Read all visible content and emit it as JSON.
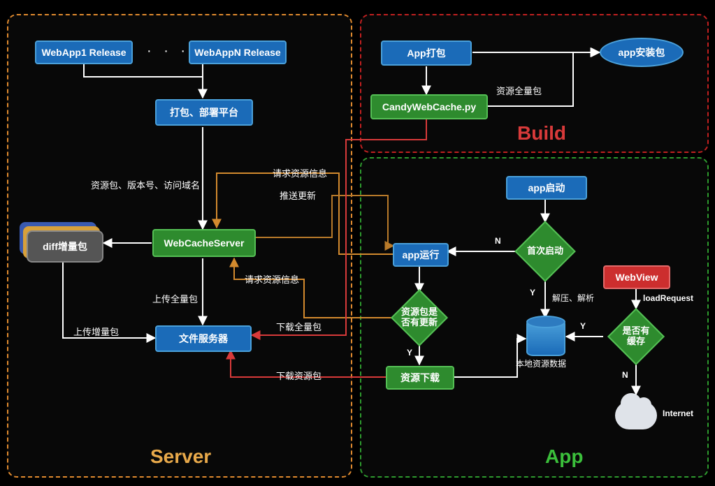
{
  "panels": {
    "server": {
      "label": "Server"
    },
    "build": {
      "label": "Build"
    },
    "app": {
      "label": "App"
    }
  },
  "nodes": {
    "webapp1": "WebApp1 Release",
    "webappn": "WebAppN Release",
    "ellipsis": "· · ·",
    "pack_platform": "打包、部署平台",
    "webcacheserver": "WebCacheServer",
    "fileserver": "文件服务器",
    "diff_pkg": "diff增量包",
    "app_pack": "App打包",
    "candy": "CandyWebCache.py",
    "app_install": "app安装包",
    "app_start": "app启动",
    "app_run": "app运行",
    "first_launch": "首次启动",
    "res_has_update": "资源包是\n否有更新",
    "res_download": "资源下载",
    "webview": "WebView",
    "has_cache": "是否有\n缓存",
    "internet": "Internet"
  },
  "edges": {
    "res_version_domain": "资源包、版本号、访问域名",
    "req_res_info_top": "请求资源信息",
    "push_update": "推送更新",
    "req_res_info_bot": "请求资源信息",
    "upload_full_pkg": "上传全量包",
    "upload_inc_pkg": "上传增量包",
    "download_full_pkg": "下载全量包",
    "download_res_pkg": "下载资源包",
    "res_full_pkg": "资源全量包",
    "first_launch_N": "N",
    "first_launch_Y": "Y",
    "unzip_parse": "解压、解析",
    "res_update_Y": "Y",
    "has_cache_Y": "Y",
    "has_cache_N": "N",
    "loadRequest": "loadRequest",
    "local_res_data": "本地资源数据"
  },
  "colors": {
    "blue": "#1b6bb8",
    "green": "#2e8b2e",
    "red": "#cc2e2e",
    "orange": "#e08a2e",
    "teal": "#d38a2e",
    "brown": "#b87a2a"
  }
}
